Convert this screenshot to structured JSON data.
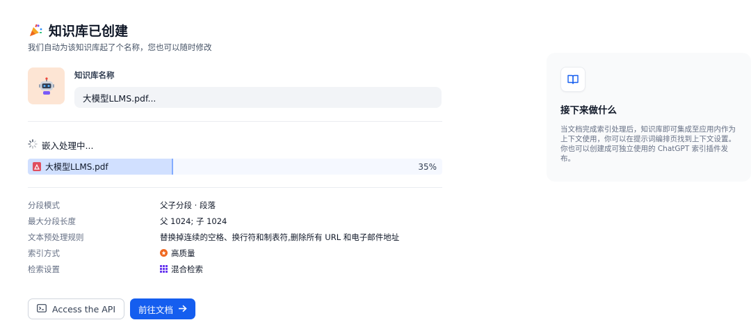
{
  "header": {
    "title": "知识库已创建",
    "subtitle": "我们自动为该知识库起了个名称，您也可以随时修改",
    "icon": "party-popper-icon"
  },
  "knowledge_base": {
    "name_label": "知识库名称",
    "name_value": "大模型LLMS.pdf...",
    "avatar_icon": "robot-icon"
  },
  "processing": {
    "status_text": "嵌入处理中...",
    "file_name": "大模型LLMS.pdf",
    "percent_text": "35%",
    "progress": 0.35
  },
  "details": [
    {
      "label": "分段模式",
      "value": "父子分段 · 段落"
    },
    {
      "label": "最大分段长度",
      "value": "父 1024; 子 1024"
    },
    {
      "label": "文本预处理规则",
      "value": "替换掉连续的空格、换行符和制表符,删除所有 URL 和电子邮件地址"
    },
    {
      "label": "索引方式",
      "value": "高质量"
    },
    {
      "label": "检索设置",
      "value": "混合检索"
    }
  ],
  "buttons": {
    "api_label": "Access the API",
    "doc_label": "前往文档"
  },
  "side_panel": {
    "title": "接下来做什么",
    "text": "当文档完成索引处理后，知识库即可集成至应用内作为上下文使用，你可以在提示词编排页找到上下文设置。你也可以创建成可独立使用的 ChatGPT 索引插件发布。"
  },
  "colors": {
    "primary": "#155eef",
    "progress_fill": "#d1e0ff",
    "pdf_red": "#e04f5f",
    "high_quality_orange": "#ef6820",
    "hybrid_purple": "#6938ef"
  }
}
